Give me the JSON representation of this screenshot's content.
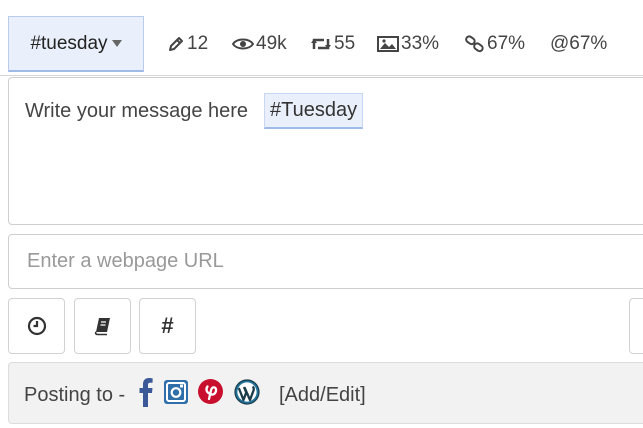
{
  "hashtag_dropdown": {
    "label": "#tuesday"
  },
  "stats": {
    "edits": "12",
    "views": "49k",
    "retweets": "55",
    "images": "33%",
    "links": "67%",
    "mentions": "67%",
    "mentions_symbol": "@"
  },
  "editor": {
    "message": "Write your message here",
    "hashtag_chip": "#Tuesday"
  },
  "url_input": {
    "placeholder": "Enter a webpage URL",
    "value": ""
  },
  "toolbar": {
    "icons": [
      "clock-icon",
      "book-icon",
      "hashtag-icon"
    ],
    "hashtag_symbol": "#"
  },
  "posting": {
    "label": "Posting to -",
    "networks": [
      "facebook",
      "instagram",
      "pinterest",
      "wordpress"
    ],
    "add_edit_label": "[Add/Edit]"
  },
  "colors": {
    "accent_bg": "#eaf0fb",
    "accent_border": "#9fbbe8",
    "facebook": "#3b5998",
    "instagram": "#2f6ea8",
    "pinterest": "#c8102e",
    "wordpress": "#21759b"
  }
}
